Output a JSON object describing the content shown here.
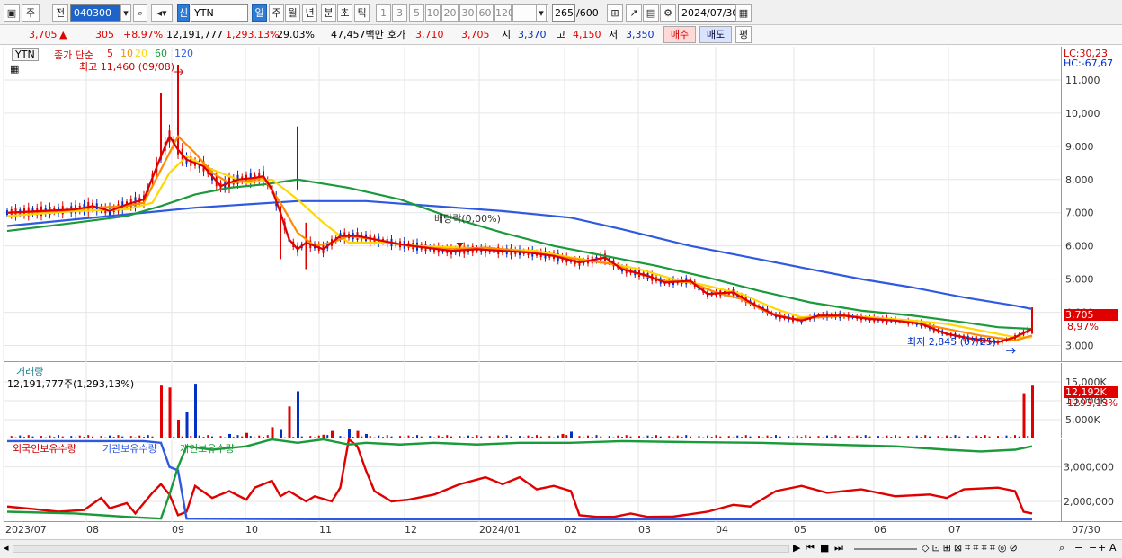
{
  "toolbar": {
    "main_button": "주",
    "prev_button": "전",
    "code": "040300",
    "market_tag": "신",
    "stock_name": "YTN",
    "periods": [
      "일",
      "주",
      "월",
      "년",
      "분",
      "초",
      "틱"
    ],
    "intervals": [
      "1",
      "3",
      "5",
      "10",
      "20",
      "30",
      "60",
      "120"
    ],
    "count": "265",
    "max_count": "/600",
    "date": "2024/07/30"
  },
  "quote": {
    "price": "3,705",
    "change_arrow": "▲",
    "change": "305",
    "change_pct": "+8.97%",
    "volume": "12,191,777",
    "volume_pct": "1,293.13%",
    "turnover": "29.03%",
    "amount": "47,457백만",
    "bid_label": "호가",
    "bid": "3,710",
    "ask": "3,705",
    "open_label": "시",
    "open": "3,370",
    "high_label": "고",
    "high": "4,150",
    "low_label": "저",
    "low": "3,350",
    "buy_button": "매수",
    "sell_button": "매도",
    "eval_button": "평"
  },
  "price_panel": {
    "name_tag": "YTN",
    "legend_prefix": "종가 단순",
    "ma_labels": [
      "5",
      "10",
      "20",
      "60",
      "120"
    ],
    "high_note": "최고 11,460 (09/08)",
    "low_note": "최저 2,845 (07/25)",
    "dividend_note": "배당락(0,00%)",
    "lc": "LC:30,23",
    "hc": "HC:-67,67",
    "last_price": "3,705",
    "last_pct": "8,97%"
  },
  "volume_panel": {
    "title": "거래량",
    "info": "12,191,777주(1,293,13%)",
    "last_label": "12,192K",
    "last_pct": "1293,13%"
  },
  "holding_panel": {
    "labels": [
      "외국인보유수량",
      "기관보유수량",
      "개인보유수량"
    ]
  },
  "colors": {
    "ma5": "#e00000",
    "ma10": "#ff8c00",
    "ma20": "#ffd700",
    "ma60": "#1a9a3a",
    "ma120": "#2f5ae0",
    "up": "#e00000",
    "down": "#0030c8"
  },
  "chart_data": {
    "type": "line",
    "x_ticks": [
      "2023/07",
      "08",
      "09",
      "10",
      "11",
      "12",
      "2024/01",
      "02",
      "03",
      "04",
      "05",
      "06",
      "07",
      "07/30"
    ],
    "price_ticks": [
      "11,000",
      "10,000",
      "9,000",
      "8,000",
      "7,000",
      "6,000",
      "5,000",
      "4,000",
      "3,000"
    ],
    "price_ylim": [
      2500,
      12000
    ],
    "volume_ticks": [
      "15,000K",
      "10,000K",
      "5,000K"
    ],
    "volume_ylim": [
      0,
      20000
    ],
    "holding_ticks": [
      "3,000,000",
      "2,000,000"
    ],
    "holding_ylim": [
      1400000,
      3800000
    ],
    "price_series": [
      {
        "key": "ma5",
        "points": [
          [
            0,
            7000
          ],
          [
            4,
            7050
          ],
          [
            8,
            7100
          ],
          [
            10,
            7200
          ],
          [
            12,
            7050
          ],
          [
            14,
            7250
          ],
          [
            16,
            7400
          ],
          [
            18,
            8700
          ],
          [
            19,
            9300
          ],
          [
            20,
            8900
          ],
          [
            21,
            8600
          ],
          [
            23,
            8400
          ],
          [
            25,
            7800
          ],
          [
            27,
            8000
          ],
          [
            29,
            8050
          ],
          [
            30,
            8100
          ],
          [
            31,
            7700
          ],
          [
            32,
            7000
          ],
          [
            33,
            6200
          ],
          [
            34,
            5900
          ],
          [
            35,
            6100
          ],
          [
            37,
            5900
          ],
          [
            39,
            6300
          ],
          [
            41,
            6300
          ],
          [
            43,
            6200
          ],
          [
            46,
            6050
          ],
          [
            49,
            5950
          ],
          [
            52,
            5850
          ],
          [
            55,
            5900
          ],
          [
            58,
            5850
          ],
          [
            61,
            5800
          ],
          [
            64,
            5700
          ],
          [
            67,
            5500
          ],
          [
            70,
            5650
          ],
          [
            72,
            5300
          ],
          [
            75,
            5100
          ],
          [
            77,
            4900
          ],
          [
            80,
            4950
          ],
          [
            82,
            4550
          ],
          [
            85,
            4600
          ],
          [
            87,
            4300
          ],
          [
            90,
            3900
          ],
          [
            93,
            3750
          ],
          [
            95,
            3900
          ],
          [
            98,
            3900
          ],
          [
            101,
            3800
          ],
          [
            104,
            3750
          ],
          [
            107,
            3650
          ],
          [
            110,
            3350
          ],
          [
            113,
            3200
          ],
          [
            116,
            3100
          ],
          [
            118,
            3250
          ],
          [
            120,
            3500
          ]
        ]
      },
      {
        "key": "ma10",
        "points": [
          [
            0,
            7000
          ],
          [
            6,
            7050
          ],
          [
            10,
            7150
          ],
          [
            14,
            7200
          ],
          [
            16,
            7300
          ],
          [
            18,
            8300
          ],
          [
            20,
            9300
          ],
          [
            22,
            8800
          ],
          [
            24,
            8200
          ],
          [
            26,
            7900
          ],
          [
            28,
            7950
          ],
          [
            30,
            8050
          ],
          [
            32,
            7300
          ],
          [
            34,
            6400
          ],
          [
            36,
            6000
          ],
          [
            38,
            6100
          ],
          [
            40,
            6300
          ],
          [
            43,
            6200
          ],
          [
            47,
            6000
          ],
          [
            52,
            5900
          ],
          [
            56,
            5950
          ],
          [
            60,
            5850
          ],
          [
            64,
            5700
          ],
          [
            68,
            5550
          ],
          [
            71,
            5450
          ],
          [
            74,
            5150
          ],
          [
            77,
            4950
          ],
          [
            80,
            4900
          ],
          [
            83,
            4600
          ],
          [
            86,
            4400
          ],
          [
            89,
            4000
          ],
          [
            92,
            3800
          ],
          [
            95,
            3850
          ],
          [
            98,
            3900
          ],
          [
            102,
            3800
          ],
          [
            106,
            3700
          ],
          [
            110,
            3500
          ],
          [
            114,
            3300
          ],
          [
            118,
            3150
          ],
          [
            120,
            3300
          ]
        ]
      },
      {
        "key": "ma20",
        "points": [
          [
            0,
            6900
          ],
          [
            8,
            7050
          ],
          [
            14,
            7100
          ],
          [
            17,
            7300
          ],
          [
            19,
            8200
          ],
          [
            21,
            8700
          ],
          [
            24,
            8300
          ],
          [
            28,
            7900
          ],
          [
            31,
            8000
          ],
          [
            34,
            7400
          ],
          [
            37,
            6700
          ],
          [
            40,
            6100
          ],
          [
            44,
            6100
          ],
          [
            48,
            6000
          ],
          [
            53,
            5950
          ],
          [
            58,
            5900
          ],
          [
            62,
            5850
          ],
          [
            66,
            5650
          ],
          [
            70,
            5500
          ],
          [
            74,
            5300
          ],
          [
            78,
            5000
          ],
          [
            82,
            4800
          ],
          [
            86,
            4550
          ],
          [
            90,
            4100
          ],
          [
            93,
            3850
          ],
          [
            97,
            3900
          ],
          [
            101,
            3850
          ],
          [
            106,
            3750
          ],
          [
            110,
            3650
          ],
          [
            114,
            3450
          ],
          [
            118,
            3250
          ],
          [
            120,
            3250
          ]
        ]
      },
      {
        "key": "ma60",
        "points": [
          [
            0,
            6450
          ],
          [
            8,
            6700
          ],
          [
            14,
            6900
          ],
          [
            18,
            7200
          ],
          [
            22,
            7550
          ],
          [
            26,
            7750
          ],
          [
            30,
            7850
          ],
          [
            34,
            8000
          ],
          [
            40,
            7750
          ],
          [
            46,
            7400
          ],
          [
            52,
            6850
          ],
          [
            58,
            6400
          ],
          [
            64,
            6000
          ],
          [
            70,
            5700
          ],
          [
            76,
            5400
          ],
          [
            82,
            5050
          ],
          [
            88,
            4650
          ],
          [
            94,
            4300
          ],
          [
            100,
            4050
          ],
          [
            106,
            3900
          ],
          [
            112,
            3700
          ],
          [
            116,
            3550
          ],
          [
            120,
            3500
          ]
        ]
      },
      {
        "key": "ma120",
        "points": [
          [
            0,
            6600
          ],
          [
            8,
            6800
          ],
          [
            16,
            7000
          ],
          [
            22,
            7150
          ],
          [
            28,
            7250
          ],
          [
            34,
            7350
          ],
          [
            42,
            7350
          ],
          [
            50,
            7200
          ],
          [
            58,
            7050
          ],
          [
            66,
            6850
          ],
          [
            72,
            6500
          ],
          [
            80,
            6000
          ],
          [
            88,
            5600
          ],
          [
            94,
            5300
          ],
          [
            100,
            5000
          ],
          [
            106,
            4750
          ],
          [
            112,
            4450
          ],
          [
            118,
            4200
          ],
          [
            120,
            4100
          ]
        ]
      }
    ],
    "holding_series": [
      {
        "key": "foreign",
        "color": "#e00000",
        "points": [
          [
            0,
            1850
          ],
          [
            3,
            1780
          ],
          [
            6,
            1700
          ],
          [
            9,
            1750
          ],
          [
            11,
            2100
          ],
          [
            12,
            1800
          ],
          [
            14,
            1950
          ],
          [
            15,
            1650
          ],
          [
            17,
            2250
          ],
          [
            18,
            2500
          ],
          [
            19,
            2200
          ],
          [
            20,
            1600
          ],
          [
            21,
            1700
          ],
          [
            22,
            2450
          ],
          [
            24,
            2100
          ],
          [
            26,
            2300
          ],
          [
            28,
            2050
          ],
          [
            29,
            2400
          ],
          [
            31,
            2600
          ],
          [
            32,
            2150
          ],
          [
            33,
            2300
          ],
          [
            35,
            2000
          ],
          [
            36,
            2150
          ],
          [
            38,
            2000
          ],
          [
            39,
            2400
          ],
          [
            40,
            3800
          ],
          [
            41,
            3600
          ],
          [
            42,
            2900
          ],
          [
            43,
            2300
          ],
          [
            45,
            2000
          ],
          [
            47,
            2050
          ],
          [
            50,
            2200
          ],
          [
            53,
            2500
          ],
          [
            56,
            2700
          ],
          [
            58,
            2500
          ],
          [
            60,
            2700
          ],
          [
            62,
            2350
          ],
          [
            64,
            2450
          ],
          [
            66,
            2300
          ],
          [
            67,
            1600
          ],
          [
            69,
            1550
          ],
          [
            71,
            1550
          ],
          [
            73,
            1650
          ],
          [
            75,
            1550
          ],
          [
            78,
            1560
          ],
          [
            82,
            1700
          ],
          [
            85,
            1900
          ],
          [
            87,
            1850
          ],
          [
            90,
            2300
          ],
          [
            93,
            2450
          ],
          [
            96,
            2250
          ],
          [
            100,
            2350
          ],
          [
            104,
            2150
          ],
          [
            108,
            2200
          ],
          [
            110,
            2100
          ],
          [
            112,
            2350
          ],
          [
            116,
            2400
          ],
          [
            118,
            2300
          ],
          [
            119,
            1700
          ],
          [
            120,
            1650
          ]
        ]
      },
      {
        "key": "institution",
        "color": "#2f5ae0",
        "points": [
          [
            0,
            3750
          ],
          [
            10,
            3750
          ],
          [
            16,
            3750
          ],
          [
            18,
            3700
          ],
          [
            19,
            3000
          ],
          [
            20,
            2900
          ],
          [
            21,
            1500
          ],
          [
            40,
            1480
          ],
          [
            60,
            1480
          ],
          [
            80,
            1480
          ],
          [
            100,
            1480
          ],
          [
            120,
            1480
          ]
        ]
      },
      {
        "key": "individual",
        "color": "#1a9a3a",
        "points": [
          [
            0,
            1700
          ],
          [
            8,
            1650
          ],
          [
            14,
            1550
          ],
          [
            18,
            1500
          ],
          [
            19,
            2200
          ],
          [
            20,
            3000
          ],
          [
            21,
            3600
          ],
          [
            24,
            3500
          ],
          [
            28,
            3600
          ],
          [
            31,
            3800
          ],
          [
            34,
            3700
          ],
          [
            37,
            3800
          ],
          [
            40,
            3650
          ],
          [
            42,
            3700
          ],
          [
            46,
            3650
          ],
          [
            50,
            3700
          ],
          [
            55,
            3650
          ],
          [
            60,
            3700
          ],
          [
            66,
            3700
          ],
          [
            72,
            3750
          ],
          [
            80,
            3720
          ],
          [
            88,
            3700
          ],
          [
            96,
            3650
          ],
          [
            104,
            3600
          ],
          [
            110,
            3500
          ],
          [
            114,
            3450
          ],
          [
            118,
            3500
          ],
          [
            120,
            3600
          ]
        ]
      }
    ],
    "volume_bars": [
      [
        18,
        14000,
        "up"
      ],
      [
        19,
        13500,
        "up"
      ],
      [
        20,
        5000,
        "up"
      ],
      [
        21,
        7000,
        "down"
      ],
      [
        22,
        14500,
        "down"
      ],
      [
        33,
        8500,
        "up"
      ],
      [
        34,
        12500,
        "down"
      ],
      [
        31,
        3000,
        "up"
      ],
      [
        32,
        2500,
        "down"
      ],
      [
        38,
        2000,
        "up"
      ],
      [
        40,
        2600,
        "down"
      ],
      [
        41,
        2000,
        "up"
      ],
      [
        37,
        1000,
        "up"
      ],
      [
        42,
        1200,
        "down"
      ],
      [
        28,
        1500,
        "up"
      ],
      [
        26,
        1200,
        "down"
      ],
      [
        65,
        1200,
        "up"
      ],
      [
        66,
        1800,
        "down"
      ],
      [
        119,
        12000,
        "up"
      ],
      [
        120,
        14000,
        "up"
      ]
    ]
  }
}
